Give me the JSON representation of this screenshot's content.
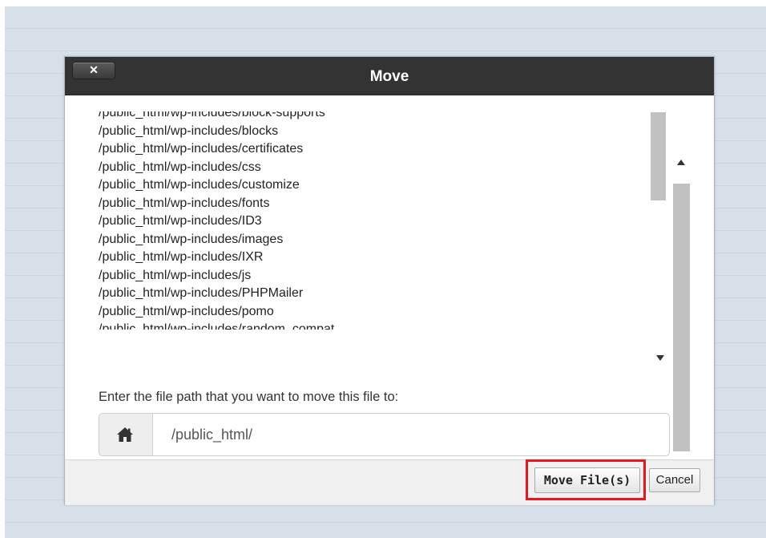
{
  "dialog": {
    "title": "Move",
    "close_label": "✕"
  },
  "directory_list": {
    "items": [
      "/public_html/wp-includes/block-supports",
      "/public_html/wp-includes/blocks",
      "/public_html/wp-includes/certificates",
      "/public_html/wp-includes/css",
      "/public_html/wp-includes/customize",
      "/public_html/wp-includes/fonts",
      "/public_html/wp-includes/ID3",
      "/public_html/wp-includes/images",
      "/public_html/wp-includes/IXR",
      "/public_html/wp-includes/js",
      "/public_html/wp-includes/PHPMailer",
      "/public_html/wp-includes/pomo",
      "/public_html/wp-includes/random_compat"
    ]
  },
  "destination": {
    "prompt": "Enter the file path that you want to move this file to:",
    "value": "/public_html/",
    "icon": "home-icon"
  },
  "footer": {
    "move_label": "Move File(s)",
    "cancel_label": "Cancel",
    "highlight_color": "#e8141e"
  },
  "colors": {
    "titlebar": "#333333",
    "backdrop": "#d7e0e8"
  }
}
